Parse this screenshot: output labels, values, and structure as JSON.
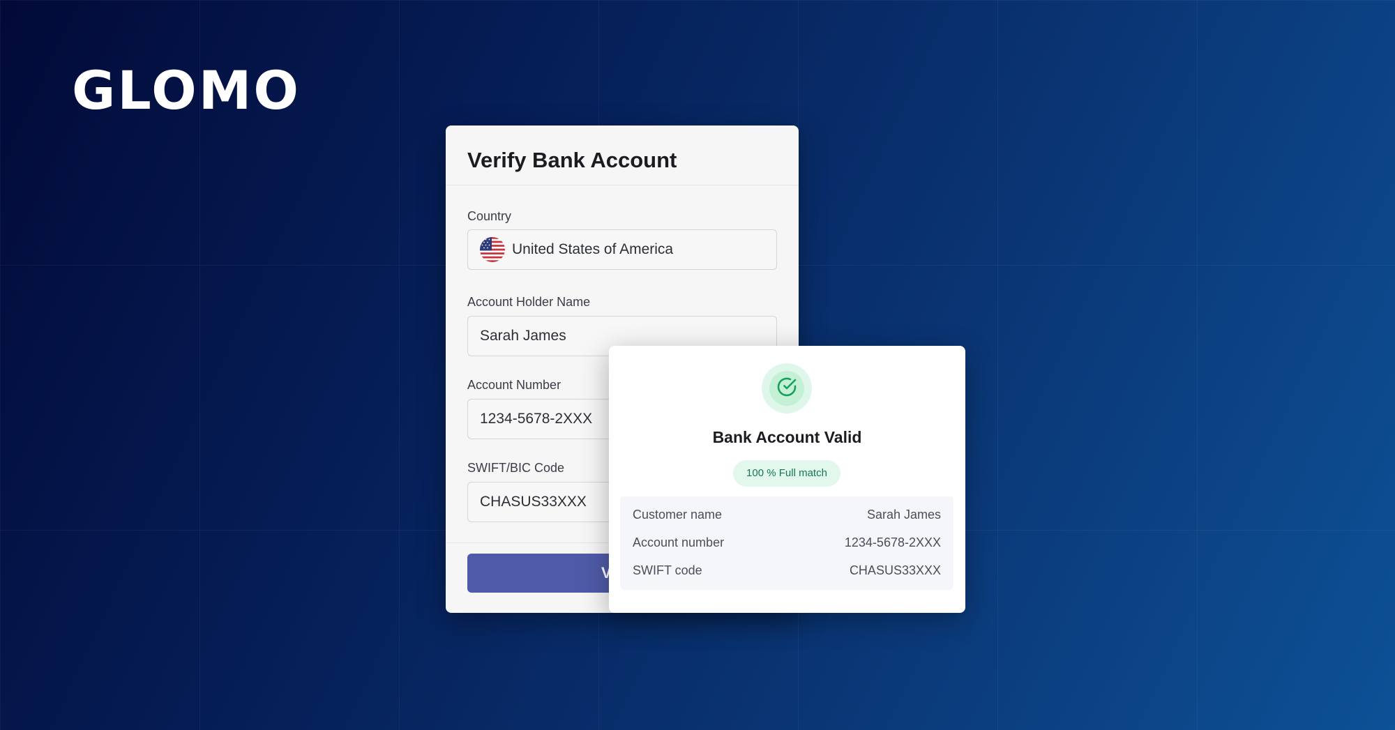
{
  "brand": {
    "logo": "GLOMO"
  },
  "form": {
    "title": "Verify Bank Account",
    "country": {
      "label": "Country",
      "value": "United States of America",
      "flag_icon": "us-flag-icon"
    },
    "holder": {
      "label": "Account Holder Name",
      "value": "Sarah James"
    },
    "account": {
      "label": "Account  Number",
      "value": "1234-5678-2XXX"
    },
    "swift": {
      "label": "SWIFT/BIC Code",
      "value": "CHASUS33XXX"
    },
    "submit_label": "Verify"
  },
  "result": {
    "icon": "check-circle-icon",
    "title": "Bank Account Valid",
    "badge": "100 % Full match",
    "rows": [
      {
        "label": "Customer name",
        "value": "Sarah James"
      },
      {
        "label": "Account number",
        "value": "1234-5678-2XXX"
      },
      {
        "label": "SWIFT code",
        "value": "CHASUS33XXX"
      }
    ]
  },
  "colors": {
    "primary_button": "#4f5ba8",
    "success": "#16a05a",
    "success_bg": "#e3f8ec"
  }
}
